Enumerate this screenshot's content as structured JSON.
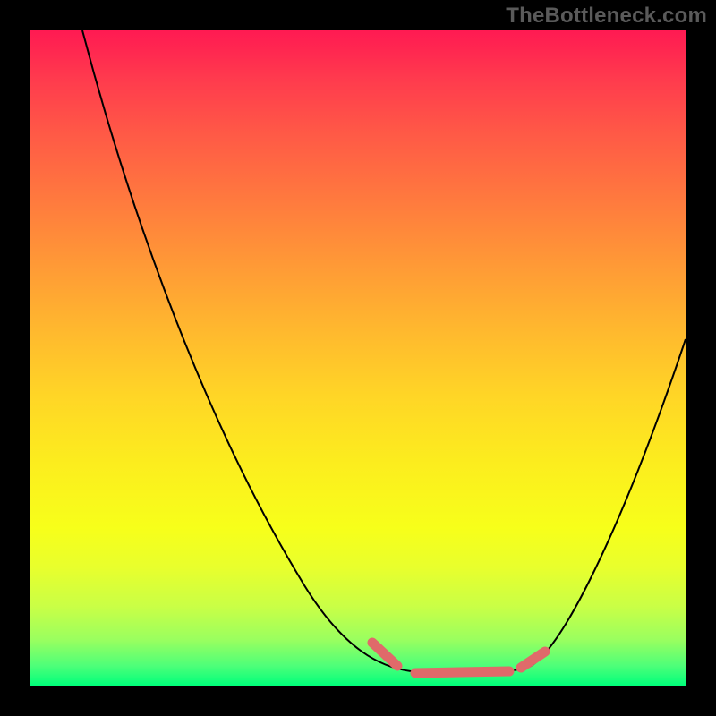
{
  "watermark": "TheBottleneck.com",
  "colors": {
    "background": "#000000",
    "curve": "#000000",
    "marker": "#e06a6a",
    "gradient_stops": [
      "#ff1a52",
      "#ff3d4d",
      "#ff5a46",
      "#ff7a3e",
      "#ff9a36",
      "#ffb92e",
      "#ffd626",
      "#fced1e",
      "#f7ff1a",
      "#e8ff2d",
      "#c9ff46",
      "#9aff5f",
      "#4dff79",
      "#00ff7a"
    ]
  },
  "chart_data": {
    "type": "line",
    "title": "",
    "xlabel": "",
    "ylabel": "",
    "xlim": [
      0,
      100
    ],
    "ylim": [
      0,
      100
    ],
    "grid": false,
    "legend": false,
    "series": [
      {
        "name": "bottleneck-curve",
        "x": [
          8,
          12,
          18,
          24,
          30,
          36,
          41,
          47,
          52,
          58,
          65,
          72,
          78,
          85,
          92,
          100
        ],
        "y": [
          100,
          88,
          74,
          60,
          46,
          32,
          20,
          10,
          4,
          2,
          2,
          3,
          7,
          17,
          34,
          53
        ]
      }
    ],
    "annotations": [
      {
        "name": "optimal-range-highlight",
        "color": "#e06a6a",
        "x_range": [
          52,
          79
        ],
        "y_approx": 2
      }
    ]
  }
}
